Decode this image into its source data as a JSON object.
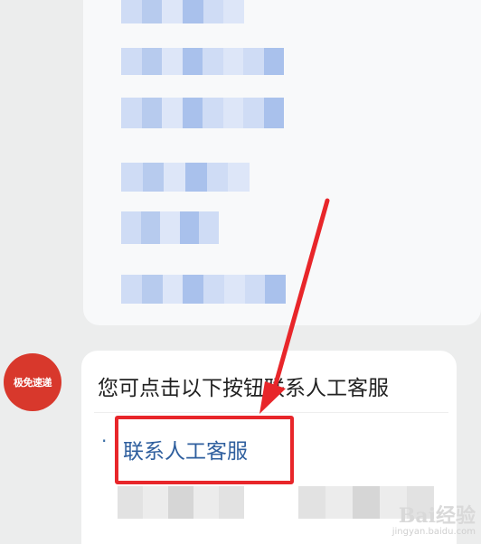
{
  "chat": {
    "avatar_label": "极免速递",
    "message_text": "您可点击以下按钮联系人工客服",
    "link_bullet": "·",
    "link_label": "联系人工客服"
  },
  "colors": {
    "highlight": "#e8262a",
    "link": "#2f5f9e",
    "avatar_bg": "#d8382c"
  },
  "icons": {
    "avatar": "bot-avatar",
    "annotation": "red-arrow"
  },
  "watermark": {
    "logo": "Bai经验",
    "url": "jingyan.baidu.com"
  }
}
